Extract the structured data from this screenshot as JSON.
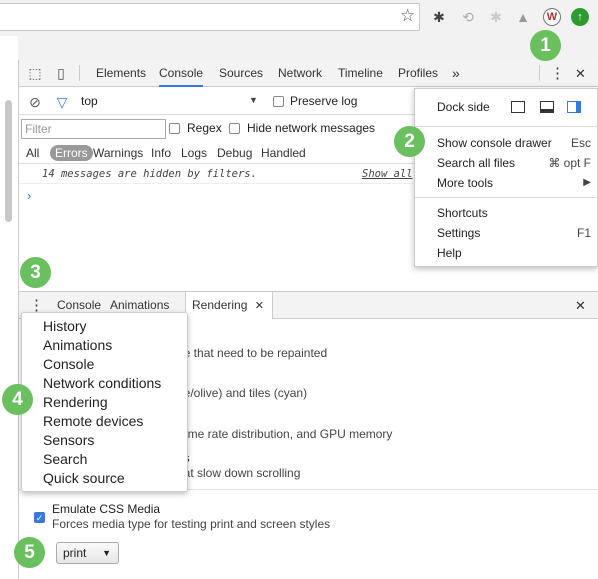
{
  "devtools": {
    "tabs": [
      "Elements",
      "Console",
      "Sources",
      "Network",
      "Timeline",
      "Profiles"
    ],
    "active_tab": "Console",
    "more_tabs": "»",
    "more_menu_icon": "⋮",
    "close_icon": "✕"
  },
  "console": {
    "context": "top",
    "preserve_log": "Preserve log",
    "filter_placeholder": "Filter",
    "regex": "Regex",
    "hide_network": "Hide network messages",
    "levels": [
      "All",
      "Errors",
      "Warnings",
      "Info",
      "Logs",
      "Debug",
      "Handled"
    ],
    "hidden_message": "14 messages are hidden by filters.",
    "show_all": "Show all",
    "prompt": "›"
  },
  "dock_menu": {
    "dock_side": "Dock side",
    "items": [
      {
        "label": "Show console drawer",
        "shortcut": "Esc"
      },
      {
        "label": "Search all files",
        "shortcut": "⌘ opt F"
      },
      {
        "label": "More tools",
        "shortcut": "▶"
      },
      {
        "label": "Shortcuts",
        "shortcut": ""
      },
      {
        "label": "Settings",
        "shortcut": "F1"
      },
      {
        "label": "Help",
        "shortcut": ""
      }
    ]
  },
  "drawer": {
    "tabs": [
      "Console",
      "Animations",
      "Rendering"
    ],
    "close_tab": "✕",
    "menu_items": [
      "History",
      "Animations",
      "Console",
      "Network conditions",
      "Rendering",
      "Remote devices",
      "Sensors",
      "Search",
      "Quick source"
    ],
    "rendering_lines": [
      "ge that need to be repainted",
      "ge/olive) and tiles (cyan)",
      "rame rate distribution, and GPU memory",
      "es",
      "hat slow down scrolling"
    ],
    "emulate_title": "Emulate CSS Media",
    "emulate_desc": "Forces media type for testing print and screen styles",
    "media_value": "print"
  },
  "badges": [
    "1",
    "2",
    "3",
    "4",
    "5"
  ],
  "colors": {
    "accent": "#3879d9",
    "badge": "#6abf5f"
  }
}
